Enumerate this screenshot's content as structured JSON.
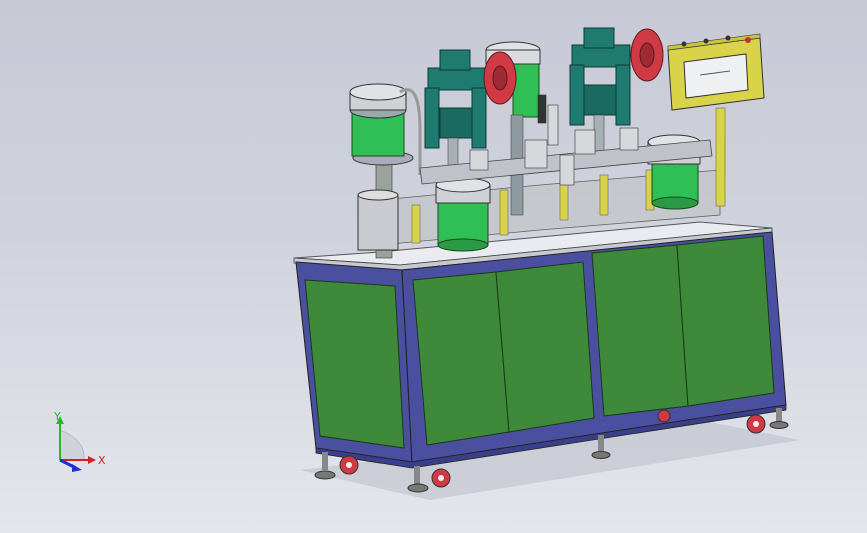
{
  "viewport": {
    "background_top": "#c7cad6",
    "background_bottom": "#e4e6ec"
  },
  "machine": {
    "frame_color": "#4a4fa0",
    "panel_color": "#3f8a3a",
    "hopper_color": "#2fbf55",
    "press_color": "#1f7a70",
    "rail_color": "#d9d34a",
    "wheel_color": "#d03a45"
  },
  "triad": {
    "x_label": "X",
    "y_label": "Y",
    "x_color": "#d42020",
    "y_color": "#2bb52b",
    "z_color": "#2030d0"
  }
}
